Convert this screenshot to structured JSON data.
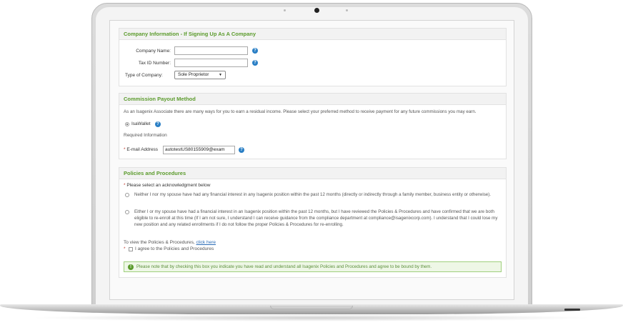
{
  "company": {
    "title": "Company Information - If Signing Up As A Company",
    "name_label": "Company Name:",
    "name_value": "",
    "taxid_label": "Tax ID Number:",
    "taxid_value": "",
    "type_label": "Type of Company:",
    "type_value": "Sole Proprietor",
    "help": "?"
  },
  "payout": {
    "title": "Commission Payout Method",
    "intro": "As an Isagenix Associate there are many ways for you to earn a residual income. Please select your preferred method to receive payment for any future commissions you may earn.",
    "option": "IsaWallet",
    "required": "Required Information",
    "email_label": "E-mail Address",
    "email_value": "autotestUS80155909@exam",
    "asterisk": "*"
  },
  "policies": {
    "title": "Policies and Procedures",
    "prompt": "Please select an acknowledgment below",
    "option1": "Neither I nor my spouse have had any financial interest in any Isagenix position within the past 12 months (directly or indirectly through a family member, business entity or otherwise).",
    "option2": "Either I or my spouse have had a financial interest in an Isagenix position within the past 12 months, but I have reviewed the Policies & Procedures and have confirmed that we are both eligible to re-enroll at this time (If I am not sure, I understand I can receive guidance from the compliance department at compliance@isagenixcorp.com). I understand that I could lose my new position and any related enrollments if I do not follow the proper Policies & Procedures for re-enrolling.",
    "view_text": "To view the Policies & Procedures,",
    "view_link": "click here",
    "agree": "I agree to the Policies and Procedures",
    "notice": "Please note that by checking this box you indicate you have read and understand all Isagenix Policies and Procedures and agree to be bound by them.",
    "notice_icon": "!"
  },
  "icons": {
    "help": "question-circle-icon",
    "notice": "exclamation-circle-icon"
  },
  "colors": {
    "accent_green": "#5b9b2c",
    "help_blue": "#2a7fc5",
    "notice_bg": "#eef7e6"
  }
}
